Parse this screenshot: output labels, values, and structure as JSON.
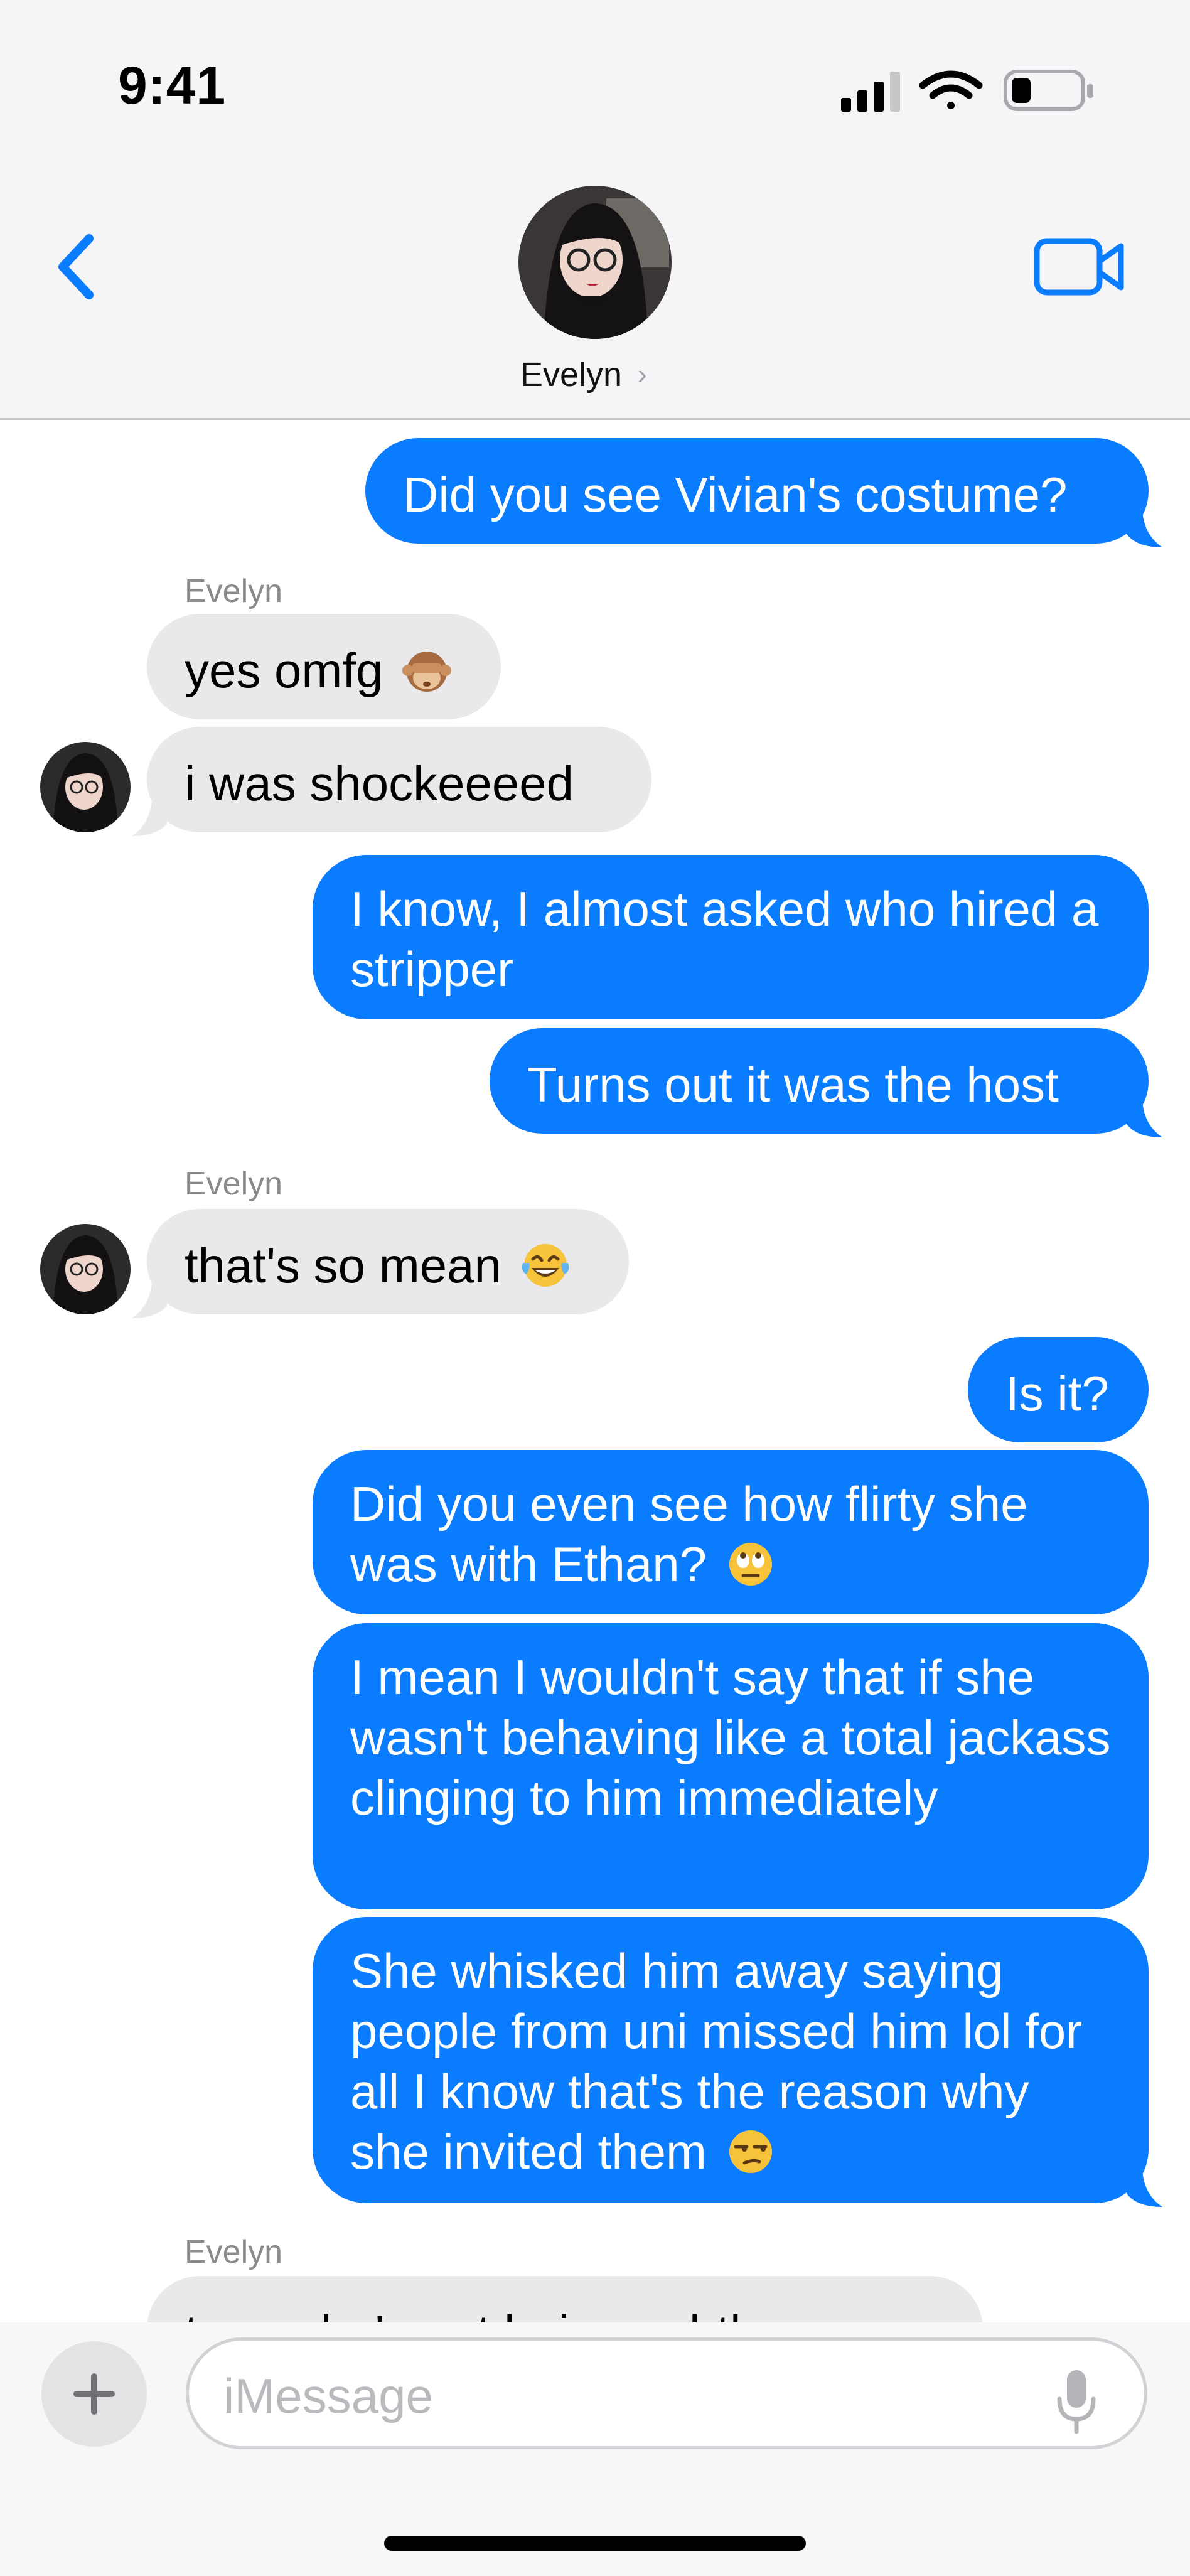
{
  "status_bar": {
    "time": "9:41"
  },
  "header": {
    "contact_name": "Evelyn",
    "chevron": "›"
  },
  "icons": {
    "back": "chevron-left-icon",
    "video": "video-camera-icon",
    "signal": "signal-icon",
    "wifi": "wifi-icon",
    "battery": "battery-icon",
    "plus": "plus-icon",
    "mic": "microphone-icon"
  },
  "colors": {
    "accent": "#0a7cff",
    "incoming": "#e9e9eb",
    "outgoing_text": "#ffffff"
  },
  "messages": [
    {
      "side": "out",
      "text": "Did you see Vivian's costume?"
    },
    {
      "side": "in",
      "sender": "Evelyn",
      "text": "yes omfg",
      "emoji": "see-no-evil-monkey"
    },
    {
      "side": "in",
      "text": "i was shockeeeed"
    },
    {
      "side": "out",
      "text": "I know, I almost asked who hired a stripper"
    },
    {
      "side": "out",
      "text": "Turns out it was the host"
    },
    {
      "side": "in",
      "sender": "Evelyn",
      "text": "that's so mean",
      "emoji": "laughing-tears"
    },
    {
      "side": "out",
      "text": "Is it?"
    },
    {
      "side": "out",
      "text": "Did you even see how flirty she was with Ethan?",
      "emoji": "eye-roll"
    },
    {
      "side": "out",
      "text": "I mean I wouldn't say that if she wasn't behaving like a total jackass clinging to him immediately"
    },
    {
      "side": "out",
      "text": "She whisked him away saying people from uni missed him lol for all I know that's the reason why she invited them",
      "emoji": "unamused"
    },
    {
      "side": "in",
      "sender": "Evelyn",
      "text": "true, she's not being subtle"
    }
  ],
  "input": {
    "placeholder": "iMessage"
  }
}
